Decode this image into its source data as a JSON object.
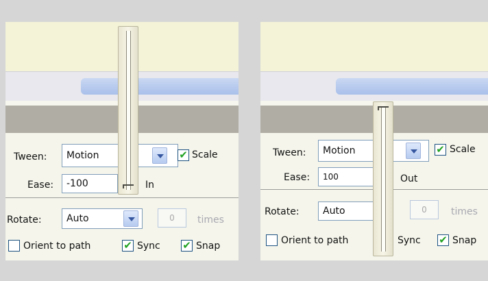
{
  "panels": [
    {
      "tween": {
        "label": "Tween:",
        "value": "Motion"
      },
      "scale": {
        "label": "Scale",
        "checked": true
      },
      "ease": {
        "label": "Ease:",
        "value": "-100",
        "direction": "In",
        "slider_level": 0
      },
      "rotate": {
        "label": "Rotate:",
        "value": "Auto",
        "times_value": "0",
        "times_label": "times"
      },
      "orient": {
        "label": "Orient to path",
        "checked": false
      },
      "sync": {
        "label": "Sync",
        "checked": true
      },
      "snap": {
        "label": "Snap",
        "checked": true
      }
    },
    {
      "tween": {
        "label": "Tween:",
        "value": "Motion"
      },
      "scale": {
        "label": "Scale",
        "checked": true
      },
      "ease": {
        "label": "Ease:",
        "value": "100",
        "direction": "Out",
        "slider_level": 1
      },
      "rotate": {
        "label": "Rotate:",
        "value": "Auto",
        "times_value": "0",
        "times_label": "times"
      },
      "orient": {
        "label": "Orient to path",
        "checked": false
      },
      "sync": {
        "label": "Sync",
        "checked": false
      },
      "snap": {
        "label": "Snap",
        "checked": true
      }
    }
  ],
  "icons": {
    "checkmark": "✔",
    "dropdown": "chevron-down-icon"
  },
  "colors": {
    "check_green": "#21a121",
    "field_border": "#7f9db9",
    "dropdown_arrow": "#3657a0"
  }
}
